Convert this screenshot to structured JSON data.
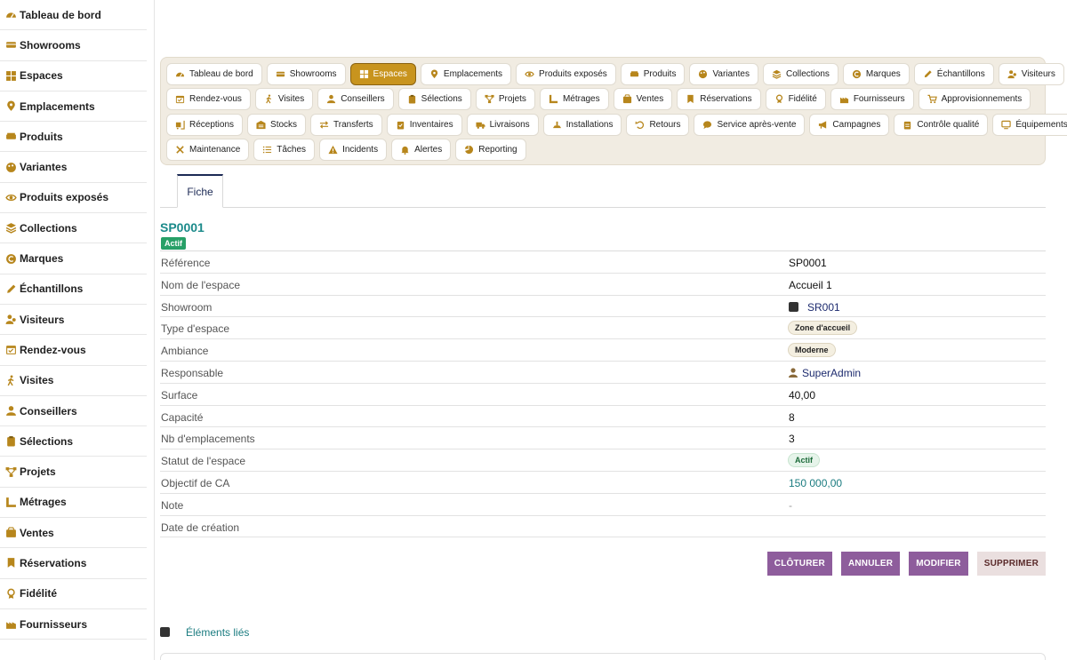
{
  "sidebar": {
    "items": [
      {
        "label": "Tableau de bord",
        "icon": "dashboard-icon"
      },
      {
        "label": "Showrooms",
        "icon": "showroom-icon"
      },
      {
        "label": "Espaces",
        "icon": "grid-icon"
      },
      {
        "label": "Emplacements",
        "icon": "map-pin-icon"
      },
      {
        "label": "Produits",
        "icon": "product-icon"
      },
      {
        "label": "Variantes",
        "icon": "palette-icon"
      },
      {
        "label": "Produits exposés",
        "icon": "eye-icon"
      },
      {
        "label": "Collections",
        "icon": "layers-icon"
      },
      {
        "label": "Marques",
        "icon": "brand-icon"
      },
      {
        "label": "Échantillons",
        "icon": "pencil-icon"
      },
      {
        "label": "Visiteurs",
        "icon": "users-icon"
      },
      {
        "label": "Rendez-vous",
        "icon": "calendar-icon"
      },
      {
        "label": "Visites",
        "icon": "walking-icon"
      },
      {
        "label": "Conseillers",
        "icon": "person-icon"
      },
      {
        "label": "Sélections",
        "icon": "clipboard-icon"
      },
      {
        "label": "Projets",
        "icon": "project-icon"
      },
      {
        "label": "Métrages",
        "icon": "ruler-icon"
      },
      {
        "label": "Ventes",
        "icon": "sale-icon"
      },
      {
        "label": "Réservations",
        "icon": "bookmark-icon"
      },
      {
        "label": "Fidélité",
        "icon": "award-icon"
      },
      {
        "label": "Fournisseurs",
        "icon": "factory-icon"
      }
    ]
  },
  "tabs": {
    "rows": [
      [
        {
          "label": "Tableau de bord",
          "icon": "dashboard-icon"
        },
        {
          "label": "Showrooms",
          "icon": "showroom-icon"
        },
        {
          "label": "Espaces",
          "icon": "grid-icon",
          "active": true
        },
        {
          "label": "Emplacements",
          "icon": "map-pin-icon"
        },
        {
          "label": "Produits exposés",
          "icon": "eye-icon"
        },
        {
          "label": "Produits",
          "icon": "product-icon"
        },
        {
          "label": "Variantes",
          "icon": "palette-icon"
        },
        {
          "label": "Collections",
          "icon": "layers-icon"
        },
        {
          "label": "Marques",
          "icon": "brand-icon"
        },
        {
          "label": "Échantillons",
          "icon": "pencil-icon"
        },
        {
          "label": "Visiteurs",
          "icon": "users-icon"
        }
      ],
      [
        {
          "label": "Rendez-vous",
          "icon": "calendar-icon"
        },
        {
          "label": "Visites",
          "icon": "walking-icon"
        },
        {
          "label": "Conseillers",
          "icon": "person-icon"
        },
        {
          "label": "Sélections",
          "icon": "clipboard-icon"
        },
        {
          "label": "Projets",
          "icon": "project-icon"
        },
        {
          "label": "Métrages",
          "icon": "ruler-icon"
        },
        {
          "label": "Ventes",
          "icon": "sale-icon"
        },
        {
          "label": "Réservations",
          "icon": "bookmark-icon"
        },
        {
          "label": "Fidélité",
          "icon": "award-icon"
        },
        {
          "label": "Fournisseurs",
          "icon": "factory-icon"
        },
        {
          "label": "Approvisionnements",
          "icon": "cart-icon"
        }
      ],
      [
        {
          "label": "Réceptions",
          "icon": "truck-loading-icon"
        },
        {
          "label": "Stocks",
          "icon": "warehouse-icon"
        },
        {
          "label": "Transferts",
          "icon": "exchange-icon"
        },
        {
          "label": "Inventaires",
          "icon": "clipboard-check-icon"
        },
        {
          "label": "Livraisons",
          "icon": "truck-icon"
        },
        {
          "label": "Installations",
          "icon": "tools-icon"
        },
        {
          "label": "Retours",
          "icon": "undo-icon"
        },
        {
          "label": "Service après-vente",
          "icon": "chat-icon"
        },
        {
          "label": "Campagnes",
          "icon": "megaphone-icon"
        },
        {
          "label": "Contrôle qualité",
          "icon": "clipboard-list-icon"
        },
        {
          "label": "Équipements",
          "icon": "monitor-icon"
        }
      ],
      [
        {
          "label": "Maintenance",
          "icon": "wrench-icon"
        },
        {
          "label": "Tâches",
          "icon": "list-icon"
        },
        {
          "label": "Incidents",
          "icon": "warning-icon"
        },
        {
          "label": "Alertes",
          "icon": "bell-icon"
        },
        {
          "label": "Reporting",
          "icon": "pie-chart-icon"
        }
      ]
    ]
  },
  "subtab": {
    "label": "Fiche"
  },
  "record": {
    "title": "SP0001",
    "status_badge": "Actif",
    "fields": {
      "reference": {
        "label": "Référence",
        "value": "SP0001"
      },
      "nom": {
        "label": "Nom de l'espace",
        "value": "Accueil 1"
      },
      "showroom": {
        "label": "Showroom",
        "value": "SR001"
      },
      "type": {
        "label": "Type d'espace",
        "value": "Zone d'accueil"
      },
      "ambiance": {
        "label": "Ambiance",
        "value": "Moderne"
      },
      "responsable": {
        "label": "Responsable",
        "value": "SuperAdmin"
      },
      "surface": {
        "label": "Surface",
        "value": "40,00"
      },
      "capacite": {
        "label": "Capacité",
        "value": "8"
      },
      "nb_emplacements": {
        "label": "Nb d'emplacements",
        "value": "3"
      },
      "statut": {
        "label": "Statut de l'espace",
        "value": "Actif"
      },
      "objectif": {
        "label": "Objectif de CA",
        "value": "150 000,00"
      },
      "note": {
        "label": "Note",
        "value": "-"
      },
      "date_creation": {
        "label": "Date de création",
        "value": ""
      }
    }
  },
  "actions": {
    "cloturer": "CLÔTURER",
    "annuler": "ANNULER",
    "modifier": "MODIFIER",
    "supprimer": "SUPPRIMER"
  },
  "linked": {
    "title": "Éléments liés"
  },
  "colors": {
    "accent": "#c8941e",
    "teal": "#1b8a8a",
    "purple_button": "#8e5d9c",
    "badge_green": "#27a067"
  }
}
